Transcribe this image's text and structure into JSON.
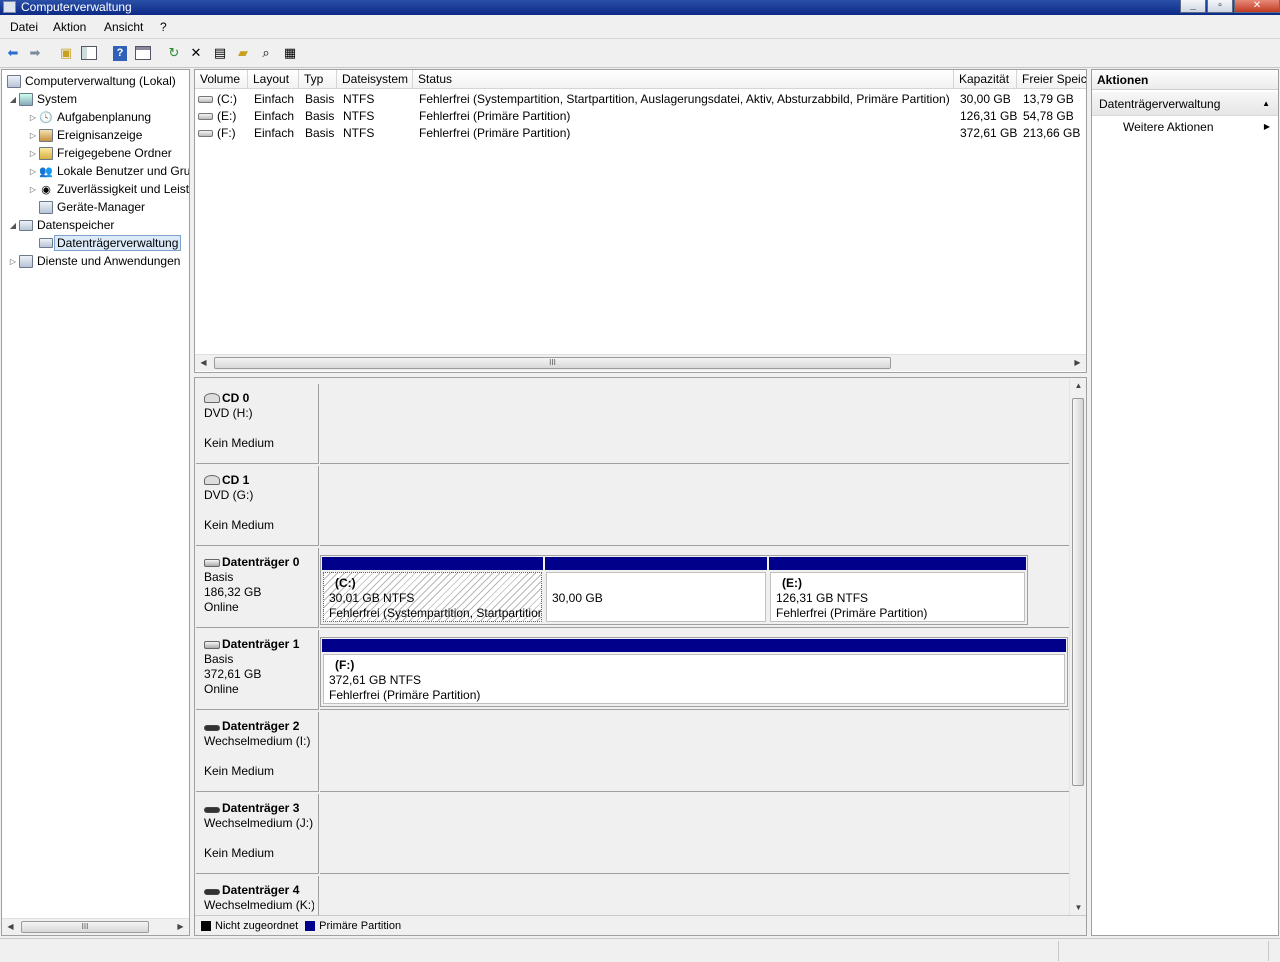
{
  "window": {
    "title": "Computerverwaltung"
  },
  "menu": [
    "Datei",
    "Aktion",
    "Ansicht",
    "?"
  ],
  "toolbar": {
    "buttons": [
      "back-icon",
      "forward-icon",
      "up-folder-icon",
      "show-tree-icon",
      "help-icon",
      "console-icon",
      "refresh-icon",
      "delete-icon",
      "properties-icon",
      "open-icon",
      "search-icon",
      "settings-icon"
    ]
  },
  "tree": {
    "items": [
      {
        "label": "Computerverwaltung (Lokal)",
        "icon": "computer-icon"
      },
      {
        "label": "System",
        "icon": "system-icon"
      },
      {
        "label": "Aufgabenplanung",
        "icon": "clock-icon"
      },
      {
        "label": "Ereignisanzeige",
        "icon": "event-viewer-icon"
      },
      {
        "label": "Freigegebene Ordner",
        "icon": "shared-folder-icon"
      },
      {
        "label": "Lokale Benutzer und Gruppen",
        "icon": "users-icon"
      },
      {
        "label": "Zuverlässigkeit und Leistung",
        "icon": "performance-icon"
      },
      {
        "label": "Geräte-Manager",
        "icon": "device-manager-icon"
      },
      {
        "label": "Datenspeicher",
        "icon": "storage-icon"
      },
      {
        "label": "Datenträgerverwaltung",
        "icon": "disk-management-icon"
      },
      {
        "label": "Dienste und Anwendungen",
        "icon": "services-icon"
      }
    ]
  },
  "volumes": {
    "columns": [
      "Volume",
      "Layout",
      "Typ",
      "Dateisystem",
      "Status",
      "Kapazität",
      "Freier Speicherplatz"
    ],
    "rows": [
      {
        "volume": "(C:)",
        "layout": "Einfach",
        "typ": "Basis",
        "fs": "NTFS",
        "status": "Fehlerfrei (Systempartition, Startpartition, Auslagerungsdatei, Aktiv, Absturzabbild, Primäre Partition)",
        "capacity": "30,00 GB",
        "free": "13,79 GB"
      },
      {
        "volume": "(E:)",
        "layout": "Einfach",
        "typ": "Basis",
        "fs": "NTFS",
        "status": "Fehlerfrei (Primäre Partition)",
        "capacity": "126,31 GB",
        "free": "54,78 GB"
      },
      {
        "volume": "(F:)",
        "layout": "Einfach",
        "typ": "Basis",
        "fs": "NTFS",
        "status": "Fehlerfrei (Primäre Partition)",
        "capacity": "372,61 GB",
        "free": "213,66 GB"
      }
    ]
  },
  "disks": [
    {
      "name": "CD 0",
      "line2": "DVD (H:)",
      "line3": "",
      "line4": "Kein Medium",
      "icon": "cd-drive-icon"
    },
    {
      "name": "CD 1",
      "line2": "DVD (G:)",
      "line3": "",
      "line4": "Kein Medium",
      "icon": "cd-drive-icon"
    },
    {
      "name": "Datenträger 0",
      "line2": "Basis",
      "line3": "186,32 GB",
      "line4": "Online",
      "icon": "hard-disk-icon",
      "partitions": [
        {
          "title": "(C:)",
          "size": "30,01 GB NTFS",
          "status": "Fehlerfrei (Systempartition, Startpartition, Auslagerungsdatei, Aktiv, Absturzabbild, Primäre Partition)"
        },
        {
          "title": "",
          "size": "30,00 GB",
          "status": ""
        },
        {
          "title": "(E:)",
          "size": "126,31 GB NTFS",
          "status": "Fehlerfrei (Primäre Partition)"
        }
      ]
    },
    {
      "name": "Datenträger 1",
      "line2": "Basis",
      "line3": "372,61 GB",
      "line4": "Online",
      "icon": "hard-disk-icon",
      "partitions": [
        {
          "title": "(F:)",
          "size": "372,61 GB NTFS",
          "status": "Fehlerfrei (Primäre Partition)"
        }
      ]
    },
    {
      "name": "Datenträger 2",
      "line2": "Wechselmedium (I:)",
      "line3": "",
      "line4": "Kein Medium",
      "icon": "removable-disk-icon"
    },
    {
      "name": "Datenträger 3",
      "line2": "Wechselmedium (J:)",
      "line3": "",
      "line4": "Kein Medium",
      "icon": "removable-disk-icon"
    },
    {
      "name": "Datenträger 4",
      "line2": "Wechselmedium (K:)",
      "line3": "",
      "line4": "",
      "icon": "removable-disk-icon"
    }
  ],
  "legend": [
    {
      "label": "Nicht zugeordnet",
      "color": "#000000"
    },
    {
      "label": "Primäre Partition",
      "color": "#00008a"
    }
  ],
  "actions": {
    "header": "Aktionen",
    "section": "Datenträgerverwaltung",
    "item": "Weitere Aktionen"
  },
  "colors": {
    "titlebar": "#0c2a86",
    "primary_partition": "#00008a",
    "selection": "#dceaf8"
  }
}
